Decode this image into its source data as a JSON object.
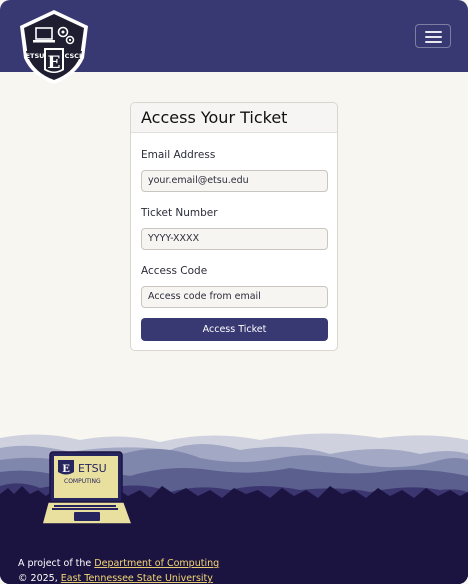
{
  "header": {
    "logo": {
      "icon": "etsu-csci-shield-logo",
      "left_text": "ETSU",
      "right_text": "CSCI",
      "letter": "E"
    },
    "menu_icon": "hamburger-menu-icon"
  },
  "card": {
    "title": "Access Your Ticket",
    "email": {
      "label": "Email Address",
      "value": "your.email@etsu.edu"
    },
    "ticket": {
      "label": "Ticket Number",
      "value": "YYYY-XXXX"
    },
    "code": {
      "label": "Access Code",
      "placeholder": "Access code from email"
    },
    "submit_label": "Access Ticket"
  },
  "footer": {
    "laptop_logo": {
      "icon": "etsu-computing-laptop-logo",
      "top_text": "ETSU",
      "bottom_text": "COMPUTING",
      "letter": "E"
    },
    "project_prefix": "A project of the ",
    "project_link": "Department of Computing",
    "copyright_prefix": "© 2025, ",
    "university_link": "East Tennessee State University"
  },
  "colors": {
    "brand": "#383973",
    "background": "#f8f6f1",
    "footer_dark": "#1c1440",
    "link": "#f3d774"
  }
}
